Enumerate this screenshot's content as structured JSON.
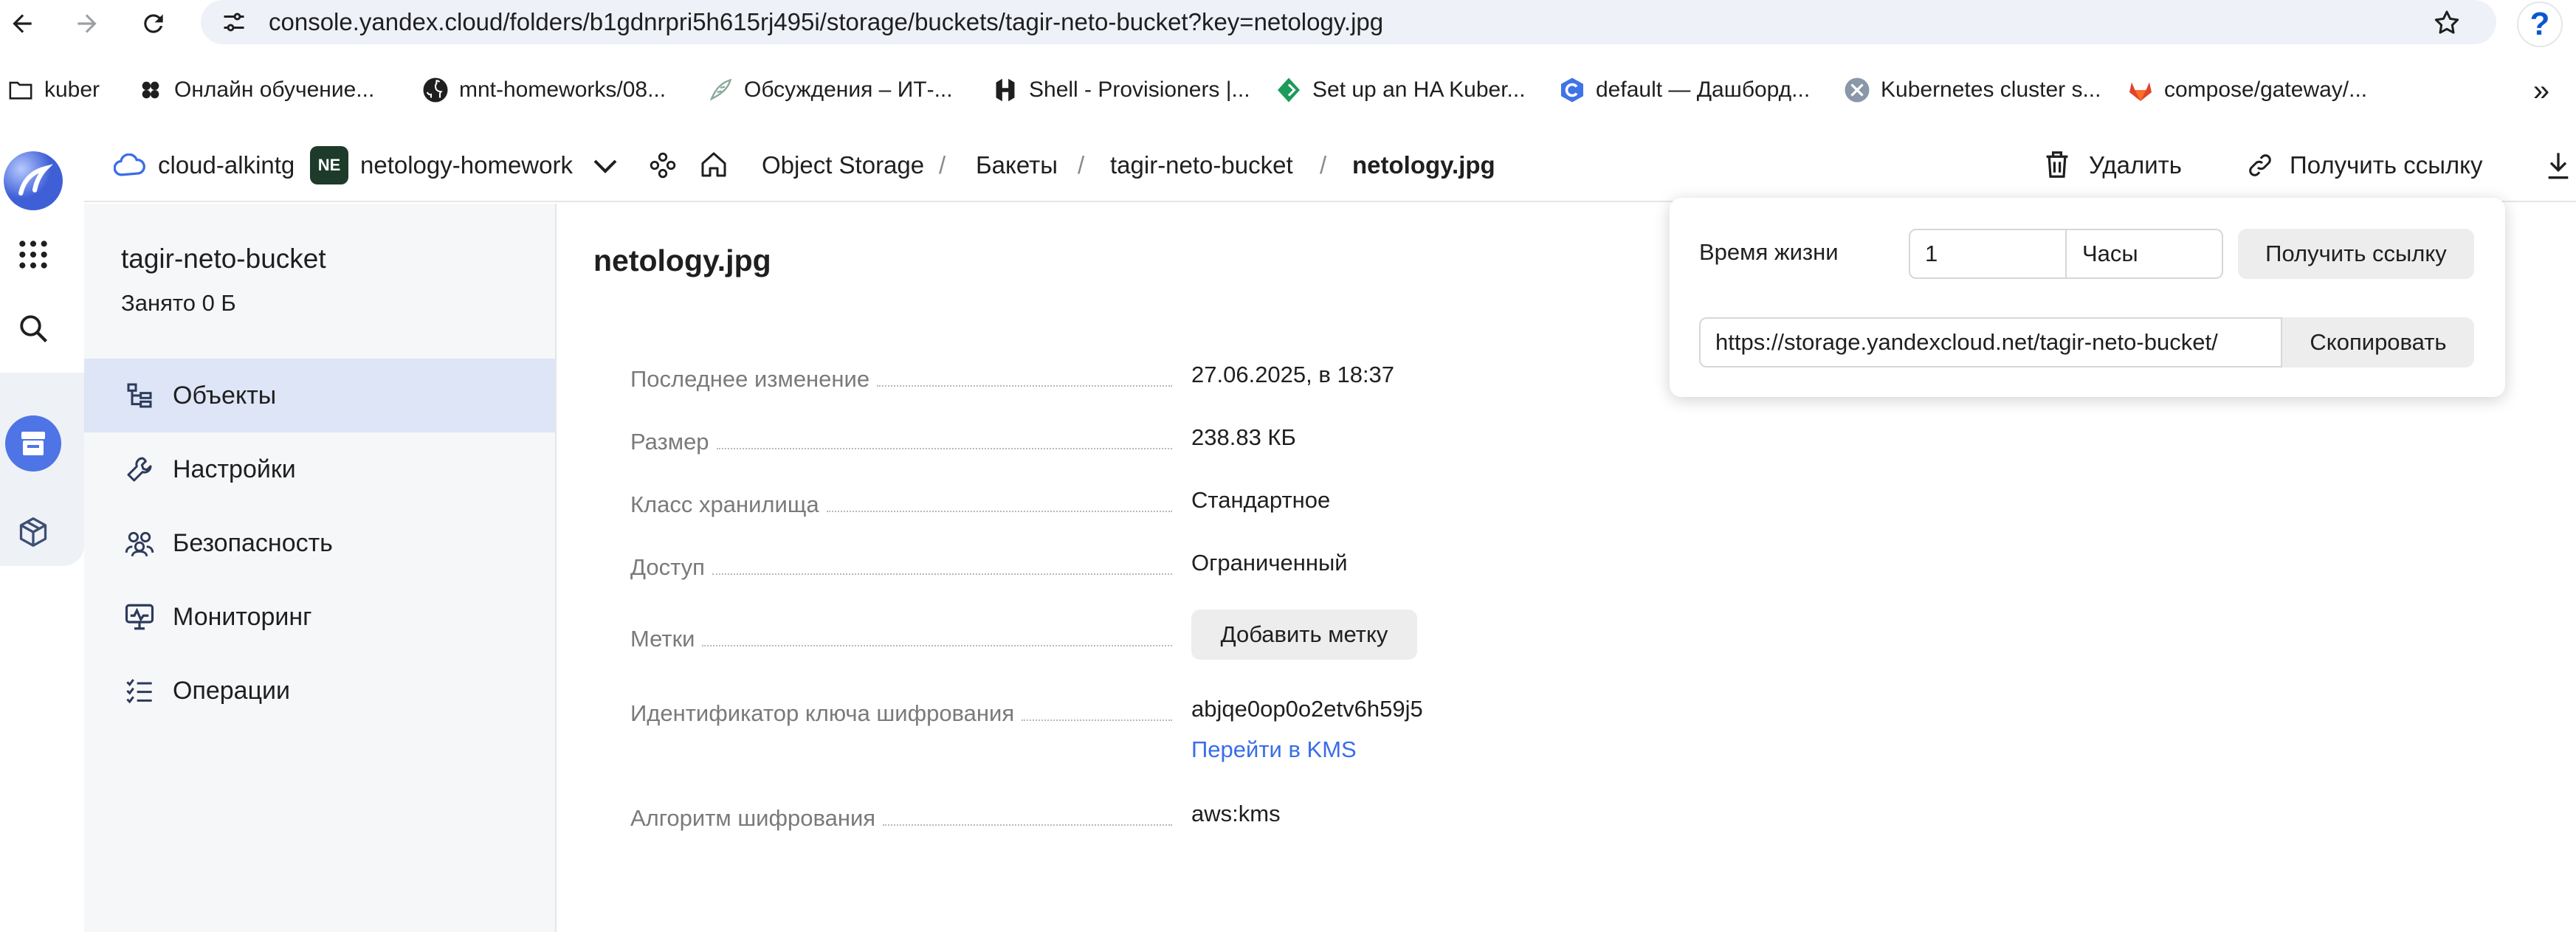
{
  "browser": {
    "url": "console.yandex.cloud/folders/b1gdnrpri5h615rj495i/storage/buckets/tagir-neto-bucket?key=netology.jpg",
    "bookmarks": [
      {
        "label": "kuber",
        "icon": "folder-icon"
      },
      {
        "label": "Онлайн обучение...",
        "icon": "dots-logo-icon"
      },
      {
        "label": "mnt-homeworks/08...",
        "icon": "github-icon"
      },
      {
        "label": "Обсуждения – ИТ-...",
        "icon": "feather-icon"
      },
      {
        "label": "Shell - Provisioners |...",
        "icon": "hashicorp-icon"
      },
      {
        "label": "Set up an HA Kuber...",
        "icon": "diamond-green-icon"
      },
      {
        "label": "default — Дашборд...",
        "icon": "c-logo-icon"
      },
      {
        "label": "Kubernetes cluster s...",
        "icon": "x-circle-icon"
      },
      {
        "label": "compose/gateway/...",
        "icon": "gitlab-icon"
      }
    ]
  },
  "header": {
    "cloud": "cloud-alkintg",
    "folder_badge": "NE",
    "folder": "netology-homework",
    "breadcrumbs": [
      "Object Storage",
      "Бакеты",
      "tagir-neto-bucket",
      "netology.jpg"
    ],
    "separator": "/",
    "delete_label": "Удалить",
    "get_link_label": "Получить ссылку"
  },
  "sidebar": {
    "bucket_name": "tagir-neto-bucket",
    "used": "Занято 0 Б",
    "items": [
      {
        "label": "Объекты",
        "icon": "objects-tree-icon"
      },
      {
        "label": "Настройки",
        "icon": "wrench-icon"
      },
      {
        "label": "Безопасность",
        "icon": "users-icon"
      },
      {
        "label": "Мониторинг",
        "icon": "monitor-icon"
      },
      {
        "label": "Операции",
        "icon": "list-icon"
      }
    ]
  },
  "main": {
    "title": "netology.jpg",
    "props": [
      {
        "label": "Последнее изменение",
        "value": "27.06.2025, в 18:37"
      },
      {
        "label": "Размер",
        "value": "238.83 КБ"
      },
      {
        "label": "Класс хранилища",
        "value": "Стандартное"
      },
      {
        "label": "Доступ",
        "value": "Ограниченный"
      },
      {
        "label": "Метки",
        "value": "Добавить метку"
      },
      {
        "label": "Идентификатор ключа шифрования",
        "value": "abjqe0op0o2etv6h59j5"
      },
      {
        "label": "Алгоритм шифрования",
        "value": "aws:kms"
      }
    ],
    "kms_link": "Перейти в KMS"
  },
  "popup": {
    "ttl_label": "Время жизни",
    "ttl_value": "1",
    "ttl_unit": "Часы",
    "get_link_button": "Получить ссылку",
    "link_value": "https://storage.yandexcloud.net/tagir-neto-bucket/",
    "copy_button": "Скопировать"
  },
  "colors": {
    "accent": "#3a6de8",
    "active_bg": "#dde5f7",
    "folder_badge_bg": "#1d3a2a"
  }
}
